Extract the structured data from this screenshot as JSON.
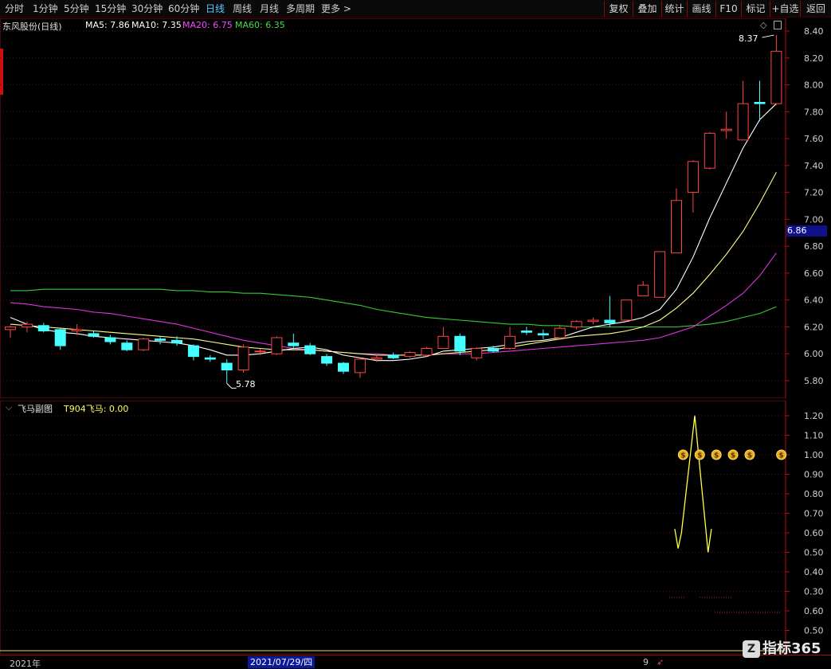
{
  "toolbar": {
    "left": [
      "分时",
      "1分钟",
      "5分钟",
      "15分钟",
      "30分钟",
      "60分钟",
      "日线",
      "周线",
      "月线",
      "多周期",
      "更多 >"
    ],
    "active": "日线",
    "right": [
      "复权",
      "叠加",
      "统计",
      "画线",
      "F10",
      "标记",
      "+自选",
      "返回"
    ]
  },
  "main": {
    "stock_name": "东风股份(日线)",
    "ma_labels": [
      {
        "text": "MA5: 7.86",
        "color": "#ffffff"
      },
      {
        "text": "MA10: 7.35",
        "color": "#ffffff"
      },
      {
        "text": "MA20: 6.75",
        "color": "#ff44ff"
      },
      {
        "text": "MA60: 6.35",
        "color": "#44dd44"
      }
    ],
    "high_label": "8.37",
    "low_label": "5.78",
    "current_price_tag": "6.86",
    "axis_ticks": [
      "8.40",
      "8.20",
      "8.00",
      "7.80",
      "7.60",
      "7.40",
      "7.20",
      "7.00",
      "6.80",
      "6.60",
      "6.40",
      "6.20",
      "6.00",
      "5.80"
    ]
  },
  "sub": {
    "title": "飞马副图",
    "indicator": "T904飞马: 0.00",
    "axis_ticks": [
      "1.20",
      "1.10",
      "1.00",
      "0.90",
      "0.80",
      "0.70",
      "0.60",
      "0.50",
      "0.40",
      "0.30",
      "0.60",
      "0.50"
    ]
  },
  "footer": {
    "year": "2021年",
    "date": "2021/07/29/四",
    "small": "9"
  },
  "watermark": {
    "logo": "Z",
    "text": "指标365"
  },
  "chart_data": {
    "type": "candlestick",
    "y_axis_range": [
      5.7,
      8.45
    ],
    "candles": [
      [
        6.18,
        6.21,
        6.12,
        6.2
      ],
      [
        6.2,
        6.24,
        6.16,
        6.22
      ],
      [
        6.21,
        6.23,
        6.16,
        6.17
      ],
      [
        6.18,
        6.19,
        6.03,
        6.06
      ],
      [
        6.17,
        6.22,
        6.14,
        6.18
      ],
      [
        6.15,
        6.17,
        6.12,
        6.13
      ],
      [
        6.12,
        6.14,
        6.07,
        6.09
      ],
      [
        6.08,
        6.1,
        6.02,
        6.03
      ],
      [
        6.03,
        6.12,
        6.02,
        6.11
      ],
      [
        6.11,
        6.13,
        6.07,
        6.1
      ],
      [
        6.1,
        6.13,
        6.06,
        6.08
      ],
      [
        6.06,
        6.07,
        5.95,
        5.98
      ],
      [
        5.97,
        5.99,
        5.94,
        5.96
      ],
      [
        5.93,
        5.96,
        5.78,
        5.88
      ],
      [
        5.88,
        6.07,
        5.86,
        6.05
      ],
      [
        6.02,
        6.04,
        5.99,
        6.02
      ],
      [
        6.0,
        6.13,
        5.99,
        6.12
      ],
      [
        6.08,
        6.15,
        6.03,
        6.06
      ],
      [
        6.06,
        6.08,
        5.99,
        6.0
      ],
      [
        5.98,
        6.0,
        5.91,
        5.93
      ],
      [
        5.93,
        5.94,
        5.85,
        5.87
      ],
      [
        5.86,
        5.97,
        5.82,
        5.96
      ],
      [
        5.96,
        5.99,
        5.94,
        5.97
      ],
      [
        5.99,
        6.01,
        5.96,
        5.97
      ],
      [
        5.98,
        6.02,
        5.97,
        6.01
      ],
      [
        5.99,
        6.05,
        5.98,
        6.04
      ],
      [
        6.04,
        6.2,
        6.04,
        6.13
      ],
      [
        6.13,
        6.15,
        5.99,
        6.02
      ],
      [
        5.97,
        6.05,
        5.95,
        6.04
      ],
      [
        6.04,
        6.06,
        6.01,
        6.02
      ],
      [
        6.04,
        6.2,
        6.03,
        6.13
      ],
      [
        6.17,
        6.2,
        6.14,
        6.16
      ],
      [
        6.15,
        6.18,
        6.11,
        6.14
      ],
      [
        6.12,
        6.21,
        6.12,
        6.19
      ],
      [
        6.2,
        6.25,
        6.18,
        6.24
      ],
      [
        6.24,
        6.27,
        6.22,
        6.25
      ],
      [
        6.25,
        6.43,
        6.2,
        6.23
      ],
      [
        6.25,
        6.4,
        6.24,
        6.4
      ],
      [
        6.43,
        6.54,
        6.43,
        6.51
      ],
      [
        6.42,
        6.76,
        6.42,
        6.76
      ],
      [
        6.75,
        7.23,
        6.75,
        7.14
      ],
      [
        7.2,
        7.44,
        7.05,
        7.43
      ],
      [
        7.38,
        7.65,
        7.37,
        7.64
      ],
      [
        7.66,
        7.8,
        7.6,
        7.67
      ],
      [
        7.59,
        8.03,
        7.59,
        7.86
      ],
      [
        7.87,
        8.03,
        7.73,
        7.86
      ],
      [
        7.86,
        8.37,
        7.85,
        8.25
      ]
    ],
    "ma5": [
      6.27,
      6.22,
      6.18,
      6.16,
      6.15,
      6.13,
      6.12,
      6.11,
      6.1,
      6.09,
      6.08,
      6.06,
      6.03,
      5.99,
      5.99,
      6.0,
      6.02,
      6.04,
      6.05,
      6.03,
      5.99,
      5.97,
      5.95,
      5.95,
      5.96,
      5.98,
      6.02,
      6.03,
      6.04,
      6.05,
      6.07,
      6.09,
      6.1,
      6.12,
      6.16,
      6.2,
      6.22,
      6.24,
      6.27,
      6.33,
      6.48,
      6.72,
      7.01,
      7.27,
      7.53,
      7.74,
      7.86
    ],
    "ma10": [
      6.22,
      6.21,
      6.2,
      6.19,
      6.18,
      6.17,
      6.16,
      6.15,
      6.14,
      6.13,
      6.12,
      6.11,
      6.09,
      6.07,
      6.05,
      6.04,
      6.03,
      6.03,
      6.03,
      6.02,
      6.01,
      6.0,
      5.99,
      5.99,
      5.99,
      5.99,
      6.0,
      6.01,
      6.02,
      6.03,
      6.05,
      6.07,
      6.09,
      6.11,
      6.13,
      6.14,
      6.15,
      6.17,
      6.2,
      6.25,
      6.34,
      6.45,
      6.59,
      6.74,
      6.91,
      7.12,
      7.35
    ],
    "ma20": [
      6.38,
      6.37,
      6.35,
      6.34,
      6.33,
      6.31,
      6.3,
      6.28,
      6.26,
      6.24,
      6.22,
      6.19,
      6.16,
      6.13,
      6.1,
      6.08,
      6.06,
      6.04,
      6.03,
      6.02,
      6.01,
      6.0,
      6.0,
      5.99,
      5.99,
      5.99,
      6.0,
      6.0,
      6.0,
      6.01,
      6.02,
      6.03,
      6.04,
      6.05,
      6.06,
      6.07,
      6.08,
      6.09,
      6.1,
      6.12,
      6.16,
      6.2,
      6.28,
      6.36,
      6.45,
      6.58,
      6.75
    ],
    "ma60": [
      6.47,
      6.47,
      6.48,
      6.48,
      6.48,
      6.48,
      6.48,
      6.48,
      6.48,
      6.48,
      6.47,
      6.47,
      6.46,
      6.46,
      6.45,
      6.45,
      6.44,
      6.43,
      6.42,
      6.4,
      6.38,
      6.36,
      6.33,
      6.31,
      6.29,
      6.27,
      6.26,
      6.25,
      6.24,
      6.23,
      6.22,
      6.22,
      6.21,
      6.21,
      6.2,
      6.2,
      6.2,
      6.2,
      6.2,
      6.2,
      6.2,
      6.21,
      6.22,
      6.24,
      6.27,
      6.3,
      6.35
    ],
    "sub_line": {
      "range": [
        0.45,
        1.25
      ],
      "points": [
        [
          39.9,
          0.62
        ],
        [
          40.1,
          0.52
        ],
        [
          40.3,
          0.6
        ],
        [
          41.1,
          1.2
        ],
        [
          41.9,
          0.5
        ],
        [
          42.1,
          0.62
        ]
      ]
    },
    "money_bag_positions": [
      40.4,
      41.4,
      42.4,
      43.4,
      44.4,
      46.3
    ]
  }
}
